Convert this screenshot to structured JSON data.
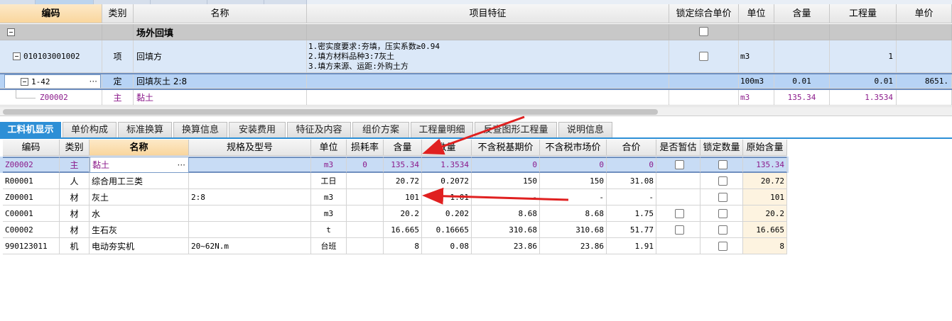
{
  "upper": {
    "headers": [
      "编码",
      "类别",
      "名称",
      "项目特征",
      "锁定综合单价",
      "单位",
      "含量",
      "工程量",
      "单价"
    ],
    "section_row": {
      "name": "场外回填"
    },
    "item_row": {
      "code": "010103001002",
      "type": "项",
      "name": "回填方",
      "features": [
        "1.密实度要求:夯填，压实系数≥0.94",
        "2.填方材料品种3:7灰土",
        "3.填方来源、运距:外购土方"
      ],
      "unit": "m3",
      "quantity": "1"
    },
    "def_row": {
      "code": "1-42",
      "dots": "···",
      "type": "定",
      "name": "回填灰土 2:8",
      "unit": "100m3",
      "content": "0.01",
      "quantity": "0.01",
      "price": "8651."
    },
    "main_row": {
      "code": "Z00002",
      "type": "主",
      "name": "黏土",
      "unit": "m3",
      "content": "135.34",
      "quantity": "1.3534"
    }
  },
  "tabs": [
    "工料机显示",
    "单价构成",
    "标准换算",
    "换算信息",
    "安装费用",
    "特征及内容",
    "组价方案",
    "工程量明细",
    "反查图形工程量",
    "说明信息"
  ],
  "lower": {
    "headers": [
      "编码",
      "类别",
      "名称",
      "规格及型号",
      "单位",
      "损耗率",
      "含量",
      "数量",
      "不含税基期价",
      "不含税市场价",
      "合价",
      "是否暂估",
      "锁定数量",
      "原始含量"
    ],
    "rows": [
      {
        "code": "Z00002",
        "type": "主",
        "name": "黏土",
        "spec": "",
        "unit": "m3",
        "loss": "0",
        "content": "135.34",
        "qty": "1.3534",
        "base": "0",
        "market": "0",
        "total": "0",
        "orig": "135.34"
      },
      {
        "code": "R00001",
        "type": "人",
        "name": "综合用工三类",
        "spec": "",
        "unit": "工日",
        "loss": "",
        "content": "20.72",
        "qty": "0.2072",
        "base": "150",
        "market": "150",
        "total": "31.08",
        "orig": "20.72"
      },
      {
        "code": "Z00001",
        "type": "材",
        "name": "灰土",
        "spec": "2:8",
        "unit": "m3",
        "loss": "",
        "content": "101",
        "qty": "1.01",
        "base": "-",
        "market": "-",
        "total": "-",
        "orig": "101"
      },
      {
        "code": "C00001",
        "type": "材",
        "name": "水",
        "spec": "",
        "unit": "m3",
        "loss": "",
        "content": "20.2",
        "qty": "0.202",
        "base": "8.68",
        "market": "8.68",
        "total": "1.75",
        "orig": "20.2"
      },
      {
        "code": "C00002",
        "type": "材",
        "name": "生石灰",
        "spec": "",
        "unit": "t",
        "loss": "",
        "content": "16.665",
        "qty": "0.16665",
        "base": "310.68",
        "market": "310.68",
        "total": "51.77",
        "orig": "16.665"
      },
      {
        "code": "990123011",
        "type": "机",
        "name": "电动夯实机",
        "spec": "20~62N.m",
        "unit": "台班",
        "loss": "",
        "content": "8",
        "qty": "0.08",
        "base": "23.86",
        "market": "23.86",
        "total": "1.91",
        "orig": "8"
      }
    ],
    "dots": "···"
  },
  "colors": {
    "accent": "#2d8fd6",
    "annotation_arrow": "#e02020",
    "selected_row": "#b7d3f5"
  }
}
